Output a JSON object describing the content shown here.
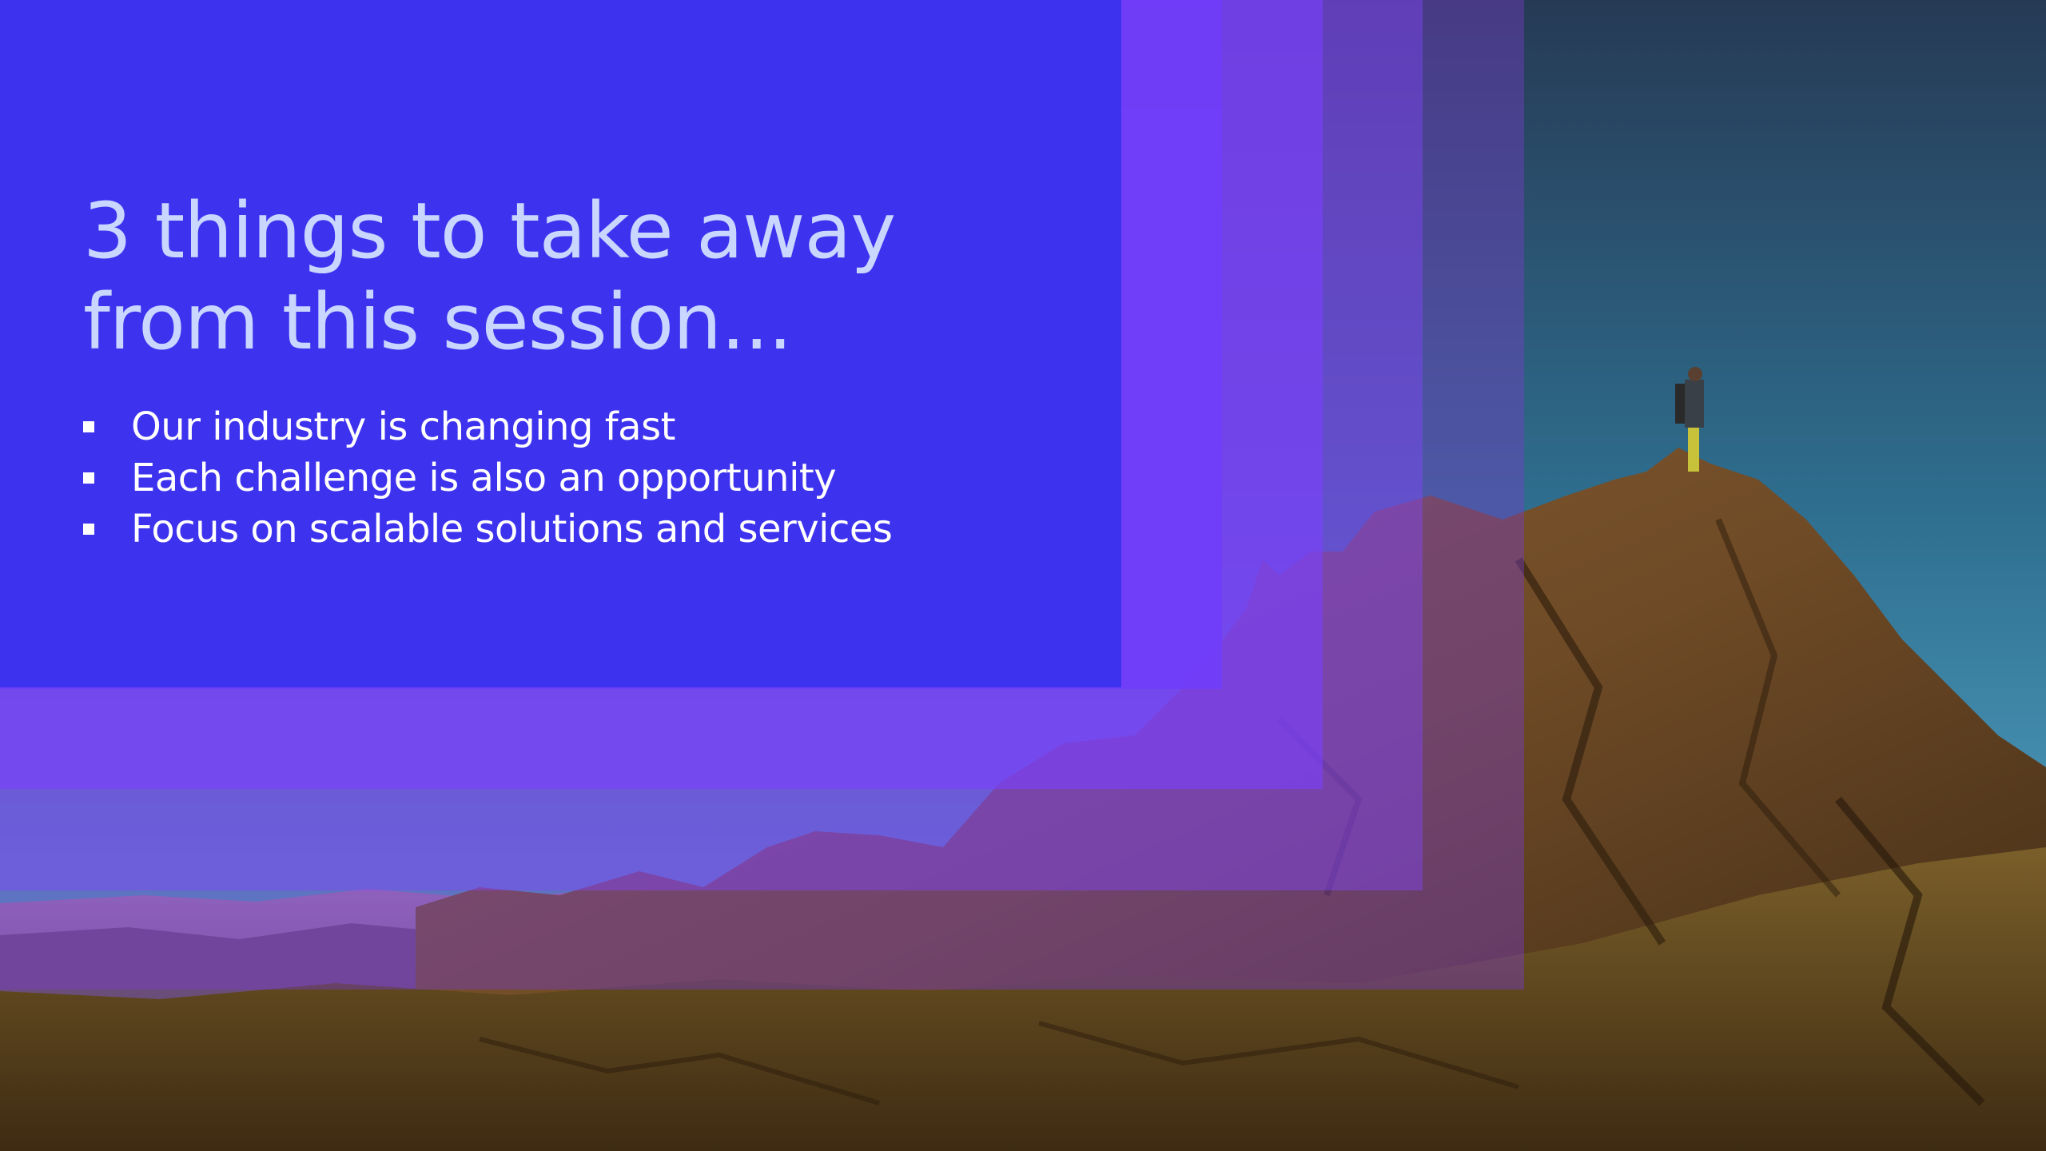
{
  "slide": {
    "title": "3 things to take away from this session...",
    "bullets": [
      "Our industry is changing fast",
      "Each challenge is also an opportunity",
      "Focus on scalable solutions and services"
    ]
  },
  "colors": {
    "panel": "#3d32ee",
    "title_text": "#c9d6ff",
    "bullet_text": "#ffffff"
  },
  "icons": [
    "square-bullet-icon"
  ]
}
